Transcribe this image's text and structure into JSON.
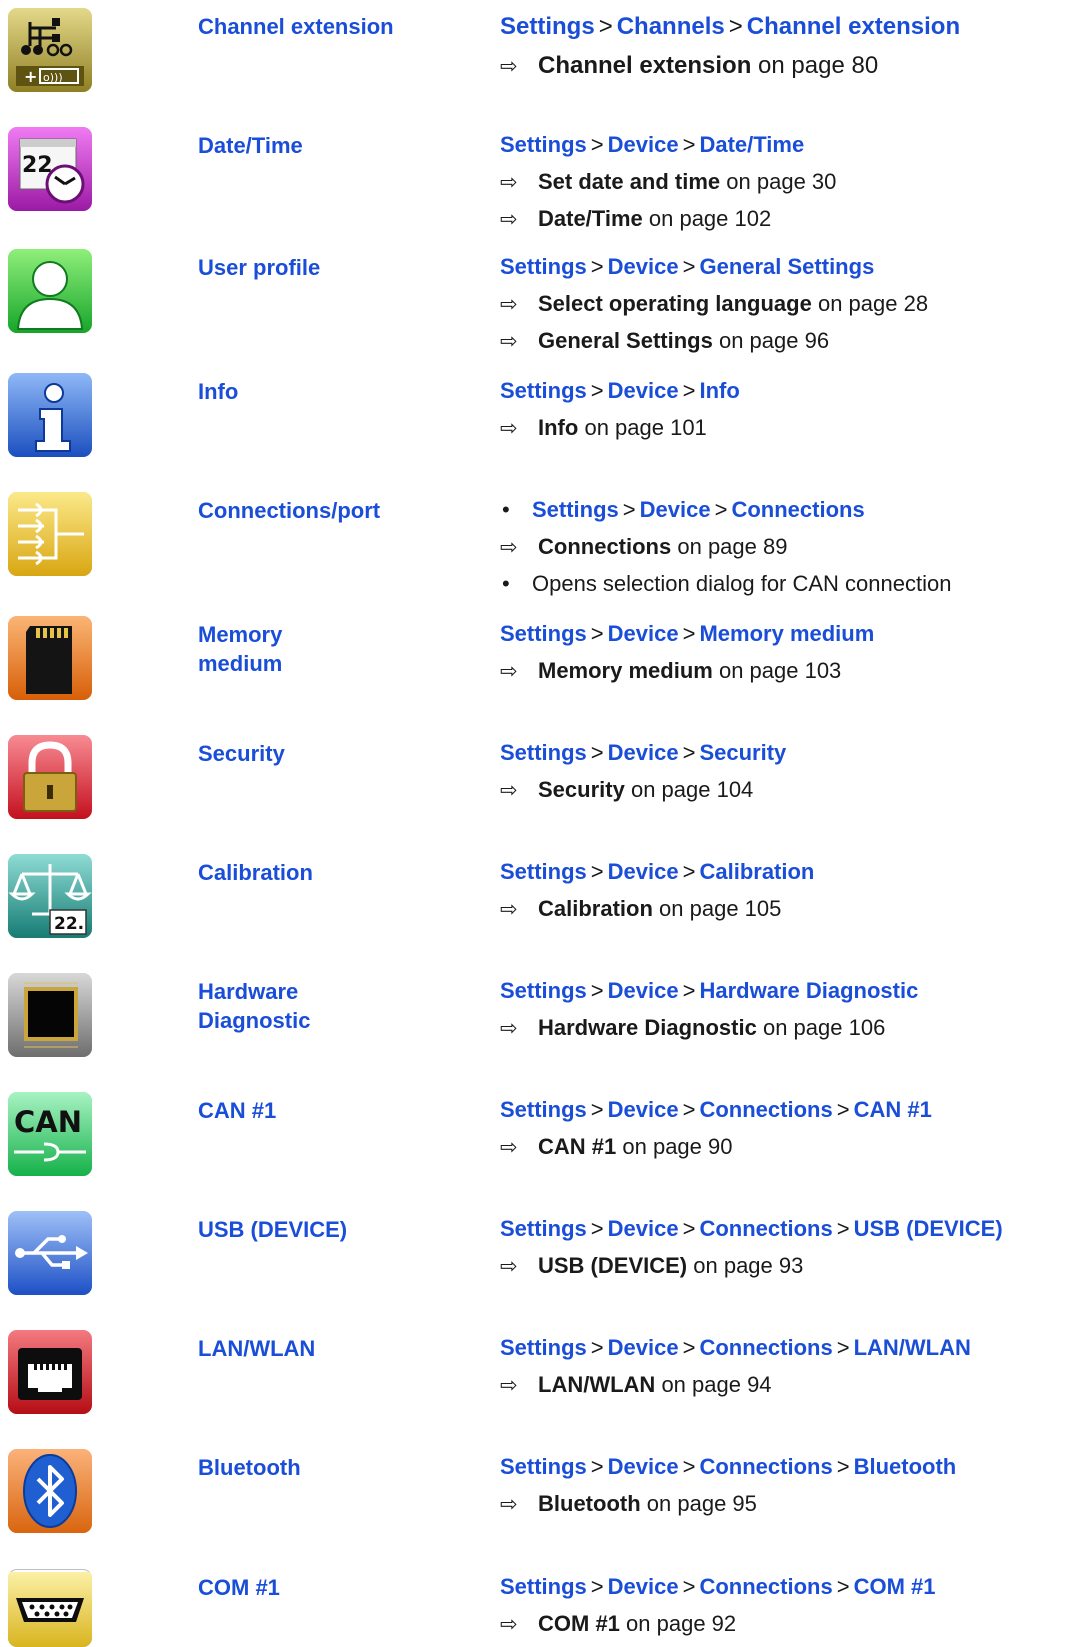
{
  "rows": [
    {
      "title": "Channel extension",
      "nav": [
        "Settings",
        "Channels",
        "Channel extension"
      ],
      "refs": [
        {
          "bold": "Channel extension",
          "rest": "on page 80"
        }
      ],
      "icon": "channel-extension-icon"
    },
    {
      "title": "Date/Time",
      "nav": [
        "Settings",
        "Device",
        "Date/Time"
      ],
      "refs": [
        {
          "bold": "Set date and time",
          "rest": "on page 30"
        },
        {
          "bold": "Date/Time",
          "rest": "on page 102"
        }
      ],
      "icon": "date-time-icon"
    },
    {
      "title": "User profile",
      "nav": [
        "Settings",
        "Device",
        "General Settings"
      ],
      "refs": [
        {
          "bold": "Select operating language",
          "rest": "on page 28"
        },
        {
          "bold": "General Settings",
          "rest": "on page 96"
        }
      ],
      "icon": "user-profile-icon"
    },
    {
      "title": "Info",
      "nav": [
        "Settings",
        "Device",
        "Info"
      ],
      "refs": [
        {
          "bold": "Info",
          "rest": "on page 101"
        }
      ],
      "icon": "info-icon"
    },
    {
      "title": "Connections/port",
      "nav": [
        "Settings",
        "Device",
        "Connections"
      ],
      "refs": [
        {
          "bold": "Connections",
          "rest": "on page 89"
        }
      ],
      "extra": "Opens selection dialog for CAN connection",
      "icon": "connections-port-icon"
    },
    {
      "title1": "Memory",
      "title2": "medium",
      "nav": [
        "Settings",
        "Device",
        "Memory medium"
      ],
      "refs": [
        {
          "bold": "Memory medium",
          "rest": "on page 103"
        }
      ],
      "icon": "memory-medium-icon"
    },
    {
      "title": "Security",
      "nav": [
        "Settings",
        "Device",
        "Security"
      ],
      "refs": [
        {
          "bold": "Security",
          "rest": "on page 104"
        }
      ],
      "icon": "security-lock-icon"
    },
    {
      "title": "Calibration",
      "nav": [
        "Settings",
        "Device",
        "Calibration"
      ],
      "refs": [
        {
          "bold": "Calibration",
          "rest": "on page 105"
        }
      ],
      "icon": "calibration-scale-icon"
    },
    {
      "title1": "Hardware",
      "title2": "Diagnostic",
      "nav": [
        "Settings",
        "Device",
        "Hardware Diagnostic"
      ],
      "refs": [
        {
          "bold": "Hardware Diagnostic",
          "rest": "on page 106"
        }
      ],
      "icon": "hardware-chip-icon"
    },
    {
      "title": "CAN #1",
      "nav": [
        "Settings",
        "Device",
        "Connections",
        "CAN #1"
      ],
      "refs": [
        {
          "bold": "CAN #1",
          "rest": "on page 90"
        }
      ],
      "icon": "can-icon"
    },
    {
      "title": "USB (DEVICE)",
      "nav": [
        "Settings",
        "Device",
        "Connections",
        "USB (DEVICE)"
      ],
      "refs": [
        {
          "bold": "USB (DEVICE)",
          "rest": "on page 93"
        }
      ],
      "icon": "usb-icon"
    },
    {
      "title": "LAN/WLAN",
      "nav": [
        "Settings",
        "Device",
        "Connections",
        "LAN/WLAN"
      ],
      "refs": [
        {
          "bold": "LAN/WLAN",
          "rest": "on page 94"
        }
      ],
      "icon": "lan-port-icon"
    },
    {
      "title": "Bluetooth",
      "nav": [
        "Settings",
        "Device",
        "Connections",
        "Bluetooth"
      ],
      "refs": [
        {
          "bold": "Bluetooth",
          "rest": "on page 95"
        }
      ],
      "icon": "bluetooth-icon"
    },
    {
      "title": "COM #1",
      "nav": [
        "Settings",
        "Device",
        "Connections",
        "COM #1"
      ],
      "refs": [
        {
          "bold": "COM #1",
          "rest": "on page 92"
        }
      ],
      "icon": "com-port-icon"
    }
  ],
  "symbols": {
    "arrow": "⇨",
    "nav_sep": ">",
    "bullet": "•"
  },
  "icon_text": {
    "date": "22.",
    "can": "CAN",
    "cal": "22."
  },
  "colors": {
    "link_blue": "#1a4ed8"
  }
}
